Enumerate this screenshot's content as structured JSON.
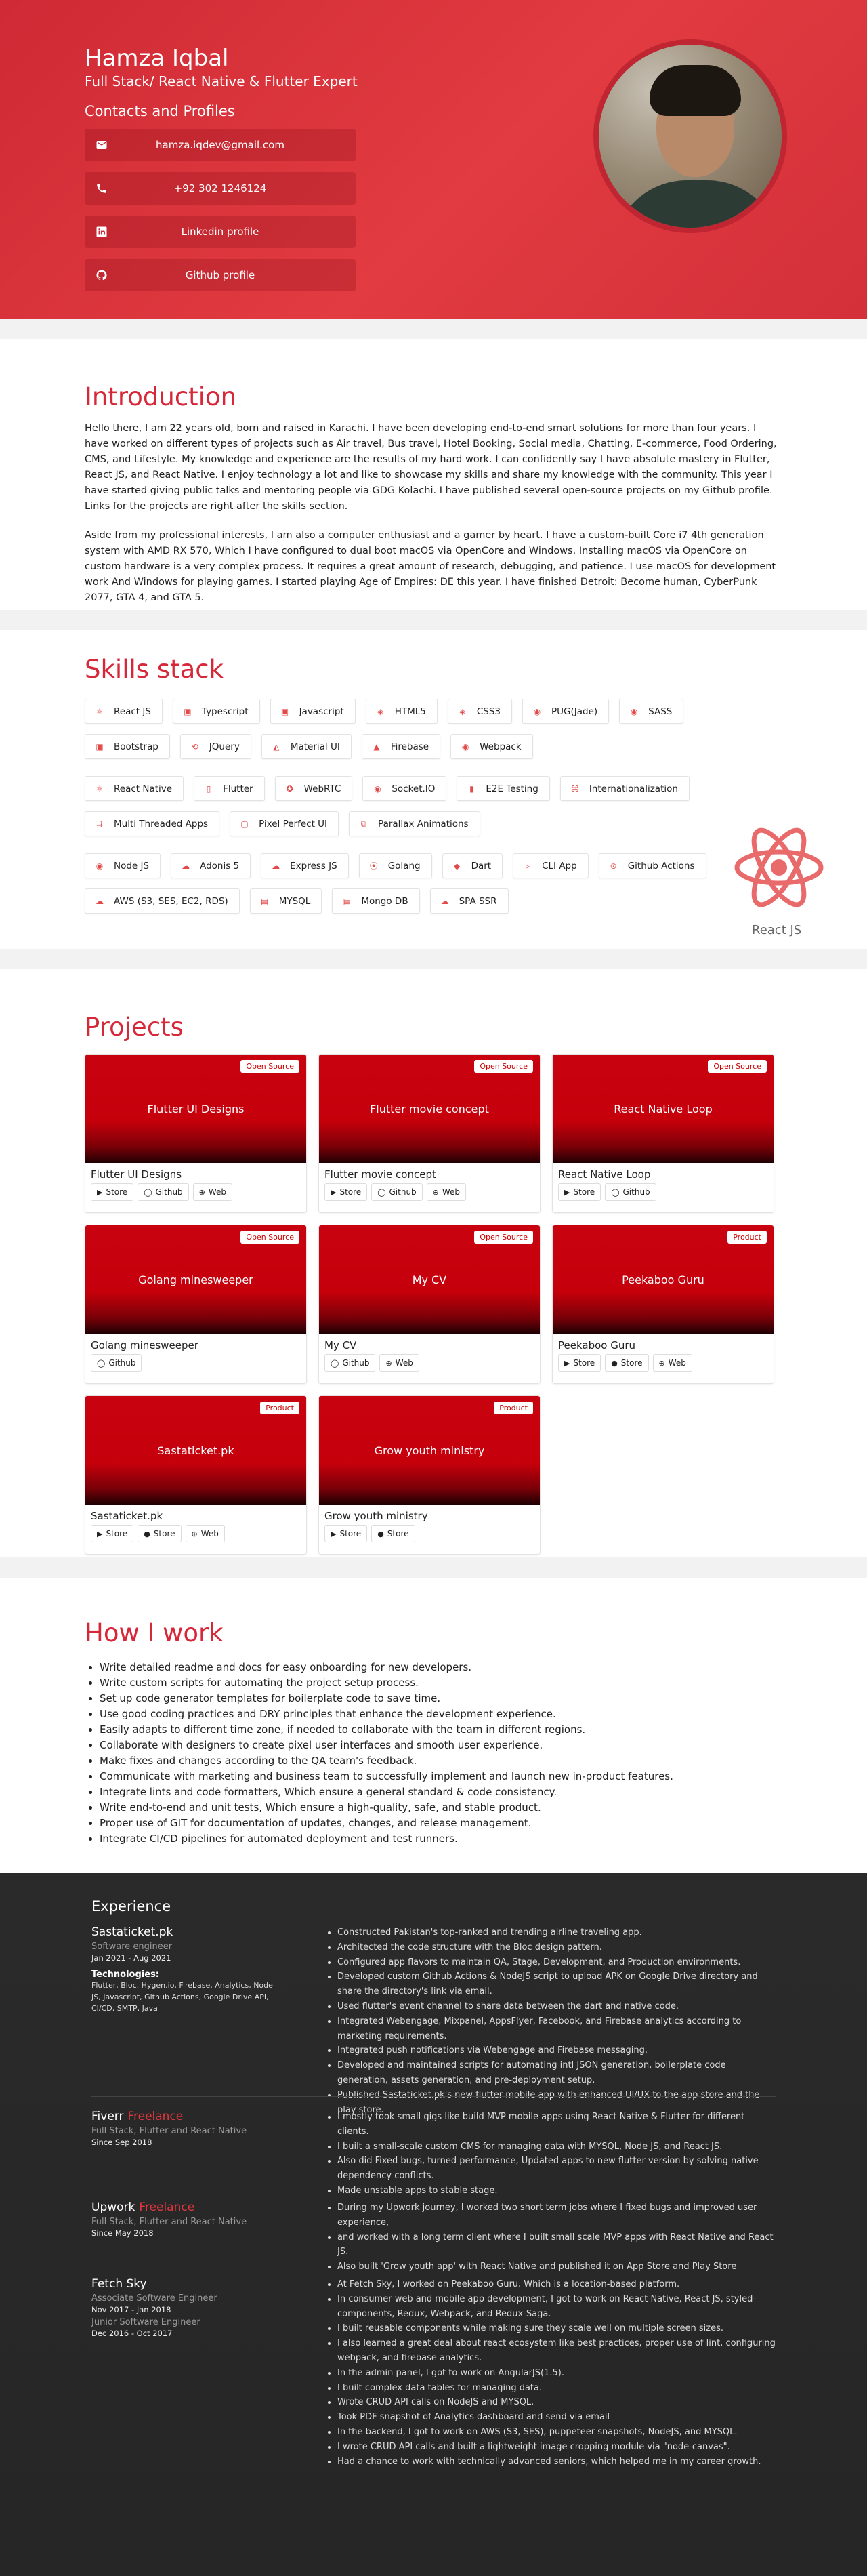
{
  "header": {
    "name": "Hamza Iqbal",
    "role": "Full Stack/ React Native & Flutter Expert",
    "contacts_title": "Contacts and Profiles",
    "contacts": [
      {
        "icon": "mail-icon",
        "label": "hamza.iqdev@gmail.com"
      },
      {
        "icon": "phone-icon",
        "label": "+92 302 1246124"
      },
      {
        "icon": "linkedin-icon",
        "label": "Linkedin profile"
      },
      {
        "icon": "github-icon",
        "label": "Github profile"
      }
    ],
    "accent": "#d7283a"
  },
  "intro": {
    "title": "Introduction",
    "p1": "Hello there, I am 22 years old, born and raised in Karachi. I have been developing end-to-end smart solutions for more than four years. I have worked on different types of projects such as Air travel, Bus travel, Hotel Booking, Social media, Chatting, E-commerce, Food Ordering, CMS, and Lifestyle. My knowledge and experience are the results of my hard work. I can confidently say I have absolute mastery in Flutter, React JS, and React Native. I enjoy technology a lot and like to showcase my skills and share my knowledge with the community. This year I have started giving public talks and mentoring people via GDG Kolachi. I have published several open-source projects on my Github profile. Links for the projects are right after the skills section.",
    "p2": "Aside from my professional interests, I am also a computer enthusiast and a gamer by heart. I have a custom-built Core i7 4th generation system with AMD RX 570, Which I have configured to dual boot macOS via OpenCore and Windows. Installing macOS via OpenCore on custom hardware is a very complex process. It requires a great amount of research, debugging, and patience. I use macOS for development work And Windows for playing games. I started playing Age of Empires: DE this year. I have finished Detroit: Become human, CyberPunk 2077, GTA 4, and GTA 5."
  },
  "skills": {
    "title": "Skills stack",
    "groups": [
      [
        "React JS",
        "Typescript",
        "Javascript",
        "HTML5",
        "CSS3",
        "PUG(Jade)",
        "SASS",
        "Bootstrap",
        "JQuery",
        "Material UI",
        "Firebase",
        "Webpack"
      ],
      [
        "React Native",
        "Flutter",
        "WebRTC",
        "Socket.IO",
        "E2E Testing",
        "Internationalization",
        "Multi Threaded Apps",
        "Pixel Perfect UI",
        "Parallax Animations"
      ],
      [
        "Node JS",
        "Adonis 5",
        "Express JS",
        "Golang",
        "Dart",
        "CLI App",
        "Github Actions",
        "AWS (S3, SES, EC2, RDS)",
        "MYSQL",
        "Mongo DB",
        "SPA SSR"
      ]
    ],
    "hover_label": "React JS"
  },
  "projects": {
    "title": "Projects",
    "items": [
      {
        "name": "Flutter UI Designs",
        "tag": "Open Source",
        "links": [
          "Store",
          "Github",
          "Web"
        ]
      },
      {
        "name": "Flutter movie concept",
        "tag": "Open Source",
        "links": [
          "Store",
          "Github",
          "Web"
        ]
      },
      {
        "name": "React Native Loop",
        "tag": "Open Source",
        "links": [
          "Store",
          "Github"
        ]
      },
      {
        "name": "Golang minesweeper",
        "tag": "Open Source",
        "links": [
          "Github"
        ]
      },
      {
        "name": "My CV",
        "tag": "Open Source",
        "links": [
          "Github",
          "Web"
        ]
      },
      {
        "name": "Peekaboo Guru",
        "tag": "Product",
        "links": [
          "Store",
          "Store",
          "Web"
        ]
      },
      {
        "name": "Sastaticket.pk",
        "tag": "Product",
        "links": [
          "Store",
          "Store",
          "Web"
        ]
      },
      {
        "name": "Grow youth ministry",
        "tag": "Product",
        "links": [
          "Store",
          "Store"
        ]
      }
    ]
  },
  "how": {
    "title": "How I work",
    "items": [
      "Write detailed readme and docs for easy onboarding for new developers.",
      "Write custom scripts for automating the project setup process.",
      "Set up code generator templates for boilerplate code to save time.",
      "Use good coding practices and DRY principles that enhance the development experience.",
      "Easily adapts to different time zone, if needed to collaborate with the team in different regions.",
      "Collaborate with designers to create pixel user interfaces and smooth user experience.",
      "Make fixes and changes according to the QA team's feedback.",
      "Communicate with marketing and business team to successfully implement and launch new in-product features.",
      "Integrate lints and code formatters, Which ensure a general standard & code consistency.",
      "Write end-to-end and unit tests, Which ensure a high-quality, safe, and stable product.",
      "Proper use of GIT for documentation of updates, changes, and release management.",
      "Integrate CI/CD pipelines for automated deployment and test runners."
    ]
  },
  "experience": {
    "title": "Experience",
    "jobs": [
      {
        "company": "Sastaticket.pk",
        "flag": "",
        "roles": [
          {
            "role": "Software engineer",
            "dates": "Jan 2021 - Aug 2021"
          }
        ],
        "tech_title": "Technologies:",
        "tech": "Flutter, Bloc, Hygen.io, Firebase, Analytics, Node JS, Javascript, Github Actions, Google Drive API, CI/CD, SMTP, Java",
        "points": [
          "Constructed Pakistan's top-ranked and trending airline traveling app.",
          "Architected the code structure with the Bloc design pattern.",
          "Configured app flavors to maintain QA, Stage, Development, and Production environments.",
          "Developed custom Github Actions & NodeJS script to upload APK on Google Drive directory and share the directory's link via email.",
          "Used flutter's event channel to share data between the dart and native code.",
          "Integrated Webengage, Mixpanel, AppsFlyer, Facebook, and Firebase analytics according to marketing requirements.",
          "Integrated push notifications via Webengage and Firebase messaging.",
          "Developed and maintained scripts for automating intl JSON generation, boilerplate code generation, assets generation, and pre-deployment setup.",
          "Published Sastaticket.pk's new flutter mobile app with enhanced UI/UX to the app store and the play store."
        ]
      },
      {
        "company": "Fiverr",
        "flag": "Freelance",
        "roles": [
          {
            "role": "Full Stack, Flutter and React Native",
            "dates": "Since Sep 2018"
          }
        ],
        "points": [
          "I mostly took small gigs like build MVP mobile apps using React Native & Flutter for different clients.",
          "I built a small-scale custom CMS for managing data with MYSQL, Node JS, and React JS.",
          "Also did Fixed bugs, turned performance, Updated apps to new flutter version by solving native dependency conflicts.",
          "Made unstable apps to stable stage."
        ]
      },
      {
        "company": "Upwork",
        "flag": "Freelance",
        "roles": [
          {
            "role": "Full Stack, Flutter and React Native",
            "dates": "Since May 2018"
          }
        ],
        "points": [
          "During my Upwork journey, I worked two short term jobs where I fixed bugs and improved user experience,",
          "and worked with a long term client where I built small scale MVP apps with React Native and React JS.",
          "Also built 'Grow youth app' with React Native and published it on App Store and Play Store"
        ]
      },
      {
        "company": "Fetch Sky",
        "flag": "",
        "roles": [
          {
            "role": "Associate Software Engineer",
            "dates": "Nov 2017 - Jan 2018"
          },
          {
            "role": "Junior Software Engineer",
            "dates": "Dec 2016 - Oct 2017"
          }
        ],
        "points": [
          "At Fetch Sky, I worked on Peekaboo Guru. Which is a location-based platform.",
          "In consumer web and mobile app development, I got to work on React Native, React JS, styled-components, Redux, Webpack, and Redux-Saga.",
          "I built reusable components while making sure they scale well on multiple screen sizes.",
          "I also learned a great deal about react ecosystem like best practices, proper use of lint, configuring webpack, and firebase analytics.",
          "In the admin panel, I got to work on AngularJS(1.5).",
          "I built complex data tables for managing data.",
          "Wrote CRUD API calls on NodeJS and MYSQL.",
          "Took PDF snapshot of Analytics dashboard and send via email",
          "In the backend, I got to work on AWS (S3, SES), puppeteer snapshots, NodeJS, and MYSQL.",
          "I wrote CRUD API calls and built a lightweight image cropping module via \"node-canvas\".",
          "Had a chance to work with technically advanced seniors, which helped me in my career growth."
        ]
      }
    ]
  }
}
